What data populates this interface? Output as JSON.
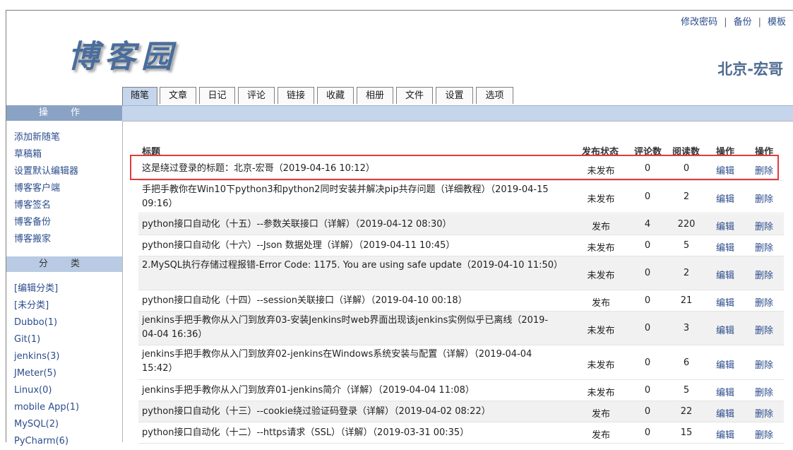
{
  "header": {
    "logo": "博客园",
    "blog_name": "北京-宏哥",
    "links": [
      "修改密码",
      "备份",
      "模板"
    ]
  },
  "tabs": [
    "随笔",
    "文章",
    "日记",
    "评论",
    "链接",
    "收藏",
    "相册",
    "文件",
    "设置",
    "选项"
  ],
  "sidebar": {
    "ops_title": "操 作",
    "ops_items": [
      "添加新随笔",
      "草稿箱",
      "设置默认编辑器",
      "博客客户端",
      "博客签名",
      "博客备份",
      "博客搬家"
    ],
    "cat_title": "分 类",
    "cat_items": [
      "[编辑分类]",
      "[未分类]",
      "Dubbo(1)",
      "Git(1)",
      "jenkins(3)",
      "JMeter(5)",
      "Linux(0)",
      "mobile App(1)",
      "MySQL(2)",
      "PyCharm(6)"
    ]
  },
  "table": {
    "headers": [
      "标题",
      "发布状态",
      "评论数",
      "阅读数",
      "操作",
      "操作"
    ],
    "edit_label": "编辑",
    "delete_label": "删除",
    "rows": [
      {
        "title": "这是绕过登录的标题：北京-宏哥（2019-04-16 10:12）",
        "status": "未发布",
        "comments": "0",
        "reads": "0"
      },
      {
        "title": "手把手教你在Win10下python3和python2同时安装并解决pip共存问题（详细教程）（2019-04-15 09:16）",
        "status": "未发布",
        "comments": "0",
        "reads": "2"
      },
      {
        "title": "python接口自动化（十五）--参数关联接口（详解）（2019-04-12 08:30）",
        "status": "发布",
        "comments": "4",
        "reads": "220"
      },
      {
        "title": "python接口自动化（十六）--Json 数据处理（详解）（2019-04-11 10:45）",
        "status": "未发布",
        "comments": "0",
        "reads": "5"
      },
      {
        "title": "2.MySQL执行存储过程报错-Error Code: 1175. You are using safe update（2019-04-10 11:50）",
        "status": "未发布",
        "comments": "0",
        "reads": "2"
      },
      {
        "title": "python接口自动化（十四）--session关联接口（详解）（2019-04-10 00:18）",
        "status": "发布",
        "comments": "0",
        "reads": "21"
      },
      {
        "title": "jenkins手把手教你从入门到放弃03-安装Jenkins时web界面出现该jenkins实例似乎已离线（2019-04-04 16:36）",
        "status": "未发布",
        "comments": "0",
        "reads": "3"
      },
      {
        "title": "jenkins手把手教你从入门到放弃02-jenkins在Windows系统安装与配置（详解）（2019-04-04 15:42）",
        "status": "未发布",
        "comments": "0",
        "reads": "6"
      },
      {
        "title": "jenkins手把手教你从入门到放弃01-jenkins简介（详解）（2019-04-04 11:08）",
        "status": "未发布",
        "comments": "0",
        "reads": "5"
      },
      {
        "title": "python接口自动化（十三）--cookie绕过验证码登录（详解）（2019-04-02 08:22）",
        "status": "发布",
        "comments": "0",
        "reads": "22"
      },
      {
        "title": "python接口自动化（十二）--https请求（SSL）（详解）（2019-03-31 00:35）",
        "status": "发布",
        "comments": "0",
        "reads": "15"
      }
    ]
  },
  "colors": {
    "accent": "#c5d6ec",
    "highlight": "#e23b3b",
    "link": "#2b4c8c"
  }
}
